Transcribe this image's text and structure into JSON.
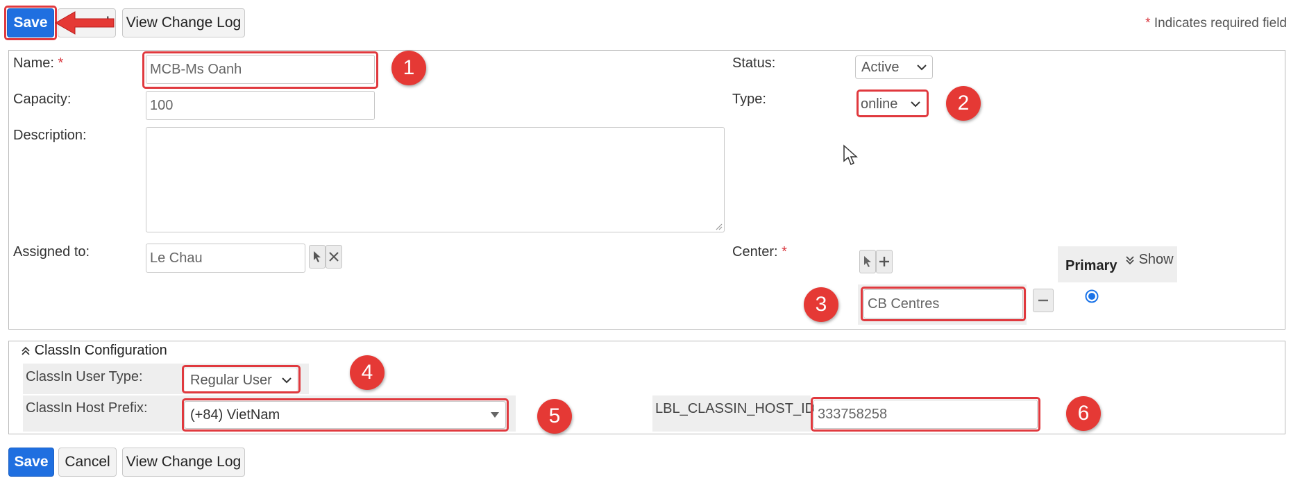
{
  "toolbar_top": {
    "save_label": "Save",
    "cancel_label": "Cancel",
    "change_log_label": "View Change Log",
    "required_note": "Indicates required field",
    "required_mark": "*"
  },
  "form": {
    "name": {
      "label": "Name:",
      "value": "MCB-Ms Oanh"
    },
    "capacity": {
      "label": "Capacity:",
      "value": "100"
    },
    "description": {
      "label": "Description:",
      "value": ""
    },
    "assigned_to": {
      "label": "Assigned to:",
      "value": "Le Chau"
    },
    "status": {
      "label": "Status:",
      "value": "Active"
    },
    "type": {
      "label": "Type:",
      "value": "online"
    },
    "center": {
      "label": "Center:",
      "value": "CB Centres",
      "primary_header": "Primary",
      "show_label": "Show",
      "primary_selected": true
    }
  },
  "classin": {
    "section_title": "ClassIn Configuration",
    "user_type": {
      "label": "ClassIn User Type:",
      "value": "Regular User"
    },
    "host_prefix": {
      "label": "ClassIn Host Prefix:",
      "value": "(+84) VietNam"
    },
    "host_id": {
      "label": "LBL_CLASSIN_HOST_ID:",
      "value": "333758258"
    }
  },
  "toolbar_bottom": {
    "save_label": "Save",
    "cancel_label": "Cancel",
    "change_log_label": "View Change Log"
  },
  "annotations": {
    "markers": [
      "1",
      "2",
      "3",
      "4",
      "5",
      "6"
    ],
    "highlight_color": "#e0393e",
    "marker_color": "#e53935"
  },
  "colors": {
    "primary_button": "#1f6fe0",
    "required": "#d9363e",
    "radio": "#1a73e8"
  }
}
